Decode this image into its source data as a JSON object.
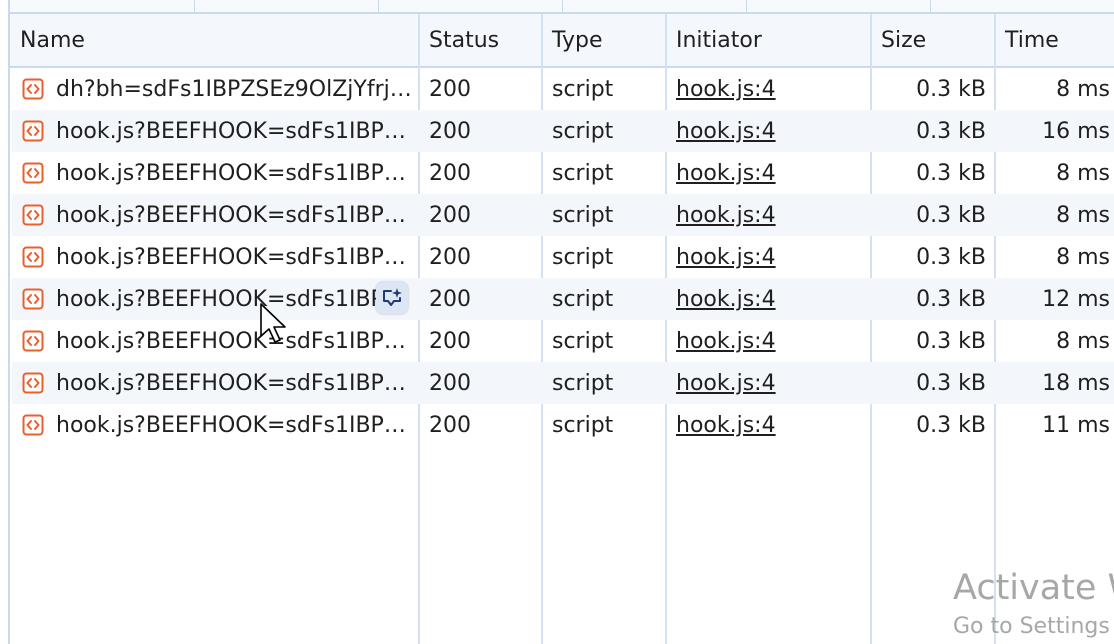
{
  "columns": {
    "name": "Name",
    "status": "Status",
    "type": "Type",
    "initiator": "Initiator",
    "size": "Size",
    "time": "Time"
  },
  "rows": [
    {
      "name": "dh?bh=sdFs1IBPZSEz9OlZjYfrj9...",
      "status": "200",
      "type": "script",
      "initiator": "hook.js:4",
      "size": "0.3 kB",
      "time": "8 ms"
    },
    {
      "name": "hook.js?BEEFHOOK=sdFs1IBPZ...",
      "status": "200",
      "type": "script",
      "initiator": "hook.js:4",
      "size": "0.3 kB",
      "time": "16 ms"
    },
    {
      "name": "hook.js?BEEFHOOK=sdFs1IBPZ...",
      "status": "200",
      "type": "script",
      "initiator": "hook.js:4",
      "size": "0.3 kB",
      "time": "8 ms"
    },
    {
      "name": "hook.js?BEEFHOOK=sdFs1IBPZ...",
      "status": "200",
      "type": "script",
      "initiator": "hook.js:4",
      "size": "0.3 kB",
      "time": "8 ms"
    },
    {
      "name": "hook.js?BEEFHOOK=sdFs1IBPZ...",
      "status": "200",
      "type": "script",
      "initiator": "hook.js:4",
      "size": "0.3 kB",
      "time": "8 ms"
    },
    {
      "name": "hook.js?BEEFHOOK=sdFs1IBPZ",
      "status": "200",
      "type": "script",
      "initiator": "hook.js:4",
      "size": "0.3 kB",
      "time": "12 ms"
    },
    {
      "name": "hook.js?BEEFHOOK=sdFs1IBPZ...",
      "status": "200",
      "type": "script",
      "initiator": "hook.js:4",
      "size": "0.3 kB",
      "time": "8 ms"
    },
    {
      "name": "hook.js?BEEFHOOK=sdFs1IBPZ...",
      "status": "200",
      "type": "script",
      "initiator": "hook.js:4",
      "size": "0.3 kB",
      "time": "18 ms"
    },
    {
      "name": "hook.js?BEEFHOOK=sdFs1IBPZ...",
      "status": "200",
      "type": "script",
      "initiator": "hook.js:4",
      "size": "0.3 kB",
      "time": "11 ms"
    }
  ],
  "icons": {
    "row_icon": "script-file-icon",
    "hover_action": "ai-sparkle-chat-icon",
    "cursor": "mouse-pointer-icon"
  },
  "colors": {
    "script_icon": "#e8602c",
    "grid_line": "#c9d9ee",
    "alt_row": "#f3f7fc"
  },
  "watermark": {
    "title": "Activate Windows",
    "subtitle": "Go to Settings to activate Windows."
  }
}
